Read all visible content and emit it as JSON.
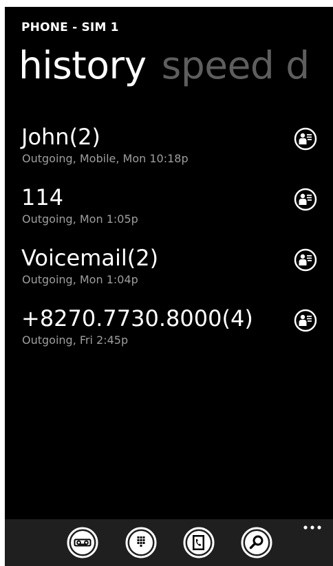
{
  "header": {
    "app_title": "PHONE - SIM 1",
    "pivots": [
      "history",
      "speed d"
    ]
  },
  "calls": [
    {
      "name": "John",
      "count": "(2)",
      "detail": "Outgoing, Mobile, Mon 10:18p"
    },
    {
      "name": "114",
      "count": "",
      "detail": "Outgoing, Mon 1:05p"
    },
    {
      "name": "Voicemail",
      "count": "(2)",
      "detail": "Outgoing, Mon 1:04p"
    },
    {
      "name": "+8270.7730.8000",
      "count": "(4)",
      "detail": "Outgoing, Fri 2:45p"
    }
  ],
  "app_bar": {
    "buttons": [
      "voicemail-icon",
      "keypad-icon",
      "phonebook-icon",
      "search-icon"
    ],
    "more": "more-icon"
  },
  "colors": {
    "background": "#000000",
    "text_primary": "#ffffff",
    "text_secondary": "#9e9e9e",
    "pivot_inactive": "#5e5e5e",
    "app_bar": "#1f1f1f"
  }
}
